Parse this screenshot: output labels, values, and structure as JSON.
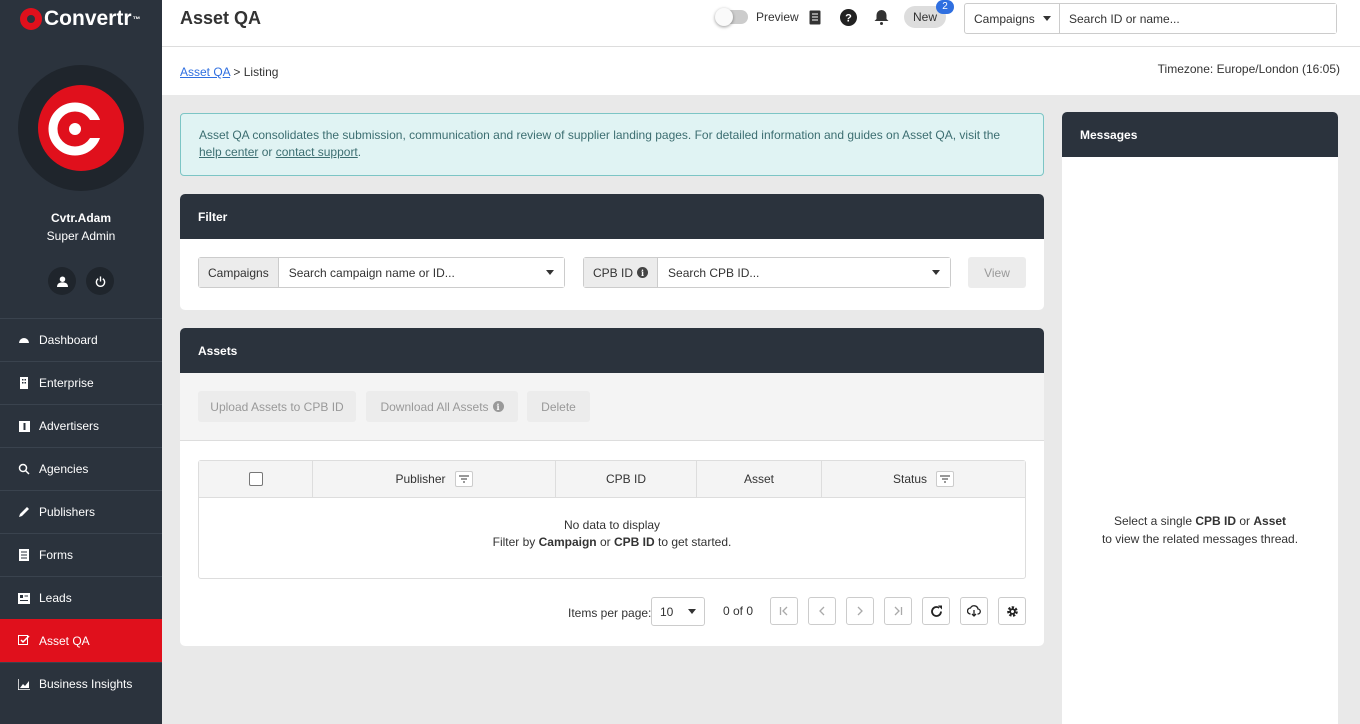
{
  "brand": {
    "name": "Convertr",
    "tm": "™",
    "accent": "#e0101c",
    "dark": "#2b333d"
  },
  "user": {
    "name": "Cvtr.Adam",
    "role": "Super Admin"
  },
  "nav": [
    {
      "label": "Dashboard",
      "icon": "dashboard-icon"
    },
    {
      "label": "Enterprise",
      "icon": "enterprise-icon"
    },
    {
      "label": "Advertisers",
      "icon": "advertisers-icon"
    },
    {
      "label": "Agencies",
      "icon": "agencies-icon"
    },
    {
      "label": "Publishers",
      "icon": "publishers-icon"
    },
    {
      "label": "Forms",
      "icon": "forms-icon"
    },
    {
      "label": "Leads",
      "icon": "leads-icon"
    },
    {
      "label": "Asset QA",
      "icon": "asset-qa-icon",
      "active": true
    },
    {
      "label": "Business Insights",
      "icon": "business-insights-icon"
    }
  ],
  "topbar": {
    "title": "Asset QA",
    "preview_label": "Preview",
    "new_label": "New",
    "new_count": "2",
    "search_scope": "Campaigns",
    "search_placeholder": "Search ID or name..."
  },
  "breadcrumb": {
    "link": "Asset QA",
    "separator": ">",
    "current": "Listing"
  },
  "timezone": "Timezone: Europe/London (16:05)",
  "info": {
    "text": "Asset QA consolidates the submission, communication and review of supplier landing pages. For detailed information and guides on Asset QA, visit the ",
    "link1": "help center",
    "mid": " or ",
    "link2": "contact support",
    "end": "."
  },
  "filter": {
    "title": "Filter",
    "campaigns_label": "Campaigns",
    "campaigns_placeholder": "Search campaign name or ID...",
    "cpb_label": "CPB ID",
    "cpb_placeholder": "Search CPB ID...",
    "view_label": "View"
  },
  "assets": {
    "title": "Assets",
    "upload_label": "Upload Assets to CPB ID",
    "download_label": "Download All Assets",
    "delete_label": "Delete",
    "columns": [
      "Publisher",
      "CPB ID",
      "Asset",
      "Status"
    ],
    "empty_line1": "No data to display",
    "empty_line2_pre": "Filter by ",
    "empty_line2_b1": "Campaign",
    "empty_line2_mid": " or ",
    "empty_line2_b2": "CPB ID",
    "empty_line2_post": " to get started."
  },
  "pager": {
    "label": "Items per page:",
    "per_page": "10",
    "count": "0 of 0"
  },
  "messages": {
    "title": "Messages",
    "pre": "Select a single ",
    "b1": "CPB ID",
    "mid": " or ",
    "b2": "Asset",
    "post": " to view the related messages thread."
  }
}
